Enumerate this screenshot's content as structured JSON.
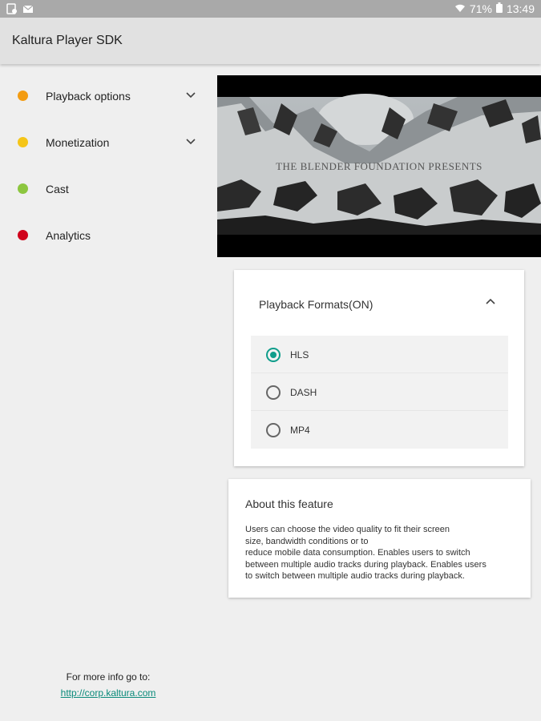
{
  "status_bar": {
    "left_icons": [
      "screen-mirroring-icon",
      "mail-icon"
    ],
    "battery_percent": "71%",
    "time": "13:49"
  },
  "app": {
    "title": "Kaltura Player SDK"
  },
  "menu": {
    "items": [
      {
        "label": "Playback options",
        "color": "#f39c12",
        "has_chevron": true
      },
      {
        "label": "Monetization",
        "color": "#f5c518",
        "has_chevron": true
      },
      {
        "label": "Cast",
        "color": "#8cc63f",
        "has_chevron": false
      },
      {
        "label": "Analytics",
        "color": "#d0021b",
        "has_chevron": false
      }
    ]
  },
  "footer": {
    "info_text": "For more info go to:",
    "link_text": "http://corp.kaltura.com"
  },
  "video": {
    "caption": "THE BLENDER FOUNDATION PRESENTS"
  },
  "playback_formats": {
    "title": "Playback Formats(ON)",
    "options": [
      {
        "label": "HLS",
        "selected": true
      },
      {
        "label": "DASH",
        "selected": false
      },
      {
        "label": "MP4",
        "selected": false
      }
    ]
  },
  "about": {
    "title": "About this feature",
    "lines": [
      "Users can choose the video quality to fit their screen",
      "size, bandwidth conditions or to",
      "reduce mobile data consumption. Enables users to switch",
      "between multiple audio tracks during playback. Enables users",
      "to switch between multiple audio tracks during playback."
    ]
  },
  "colors": {
    "accent": "#0f9d8b",
    "app_bar": "#e1e1e1",
    "status_bar": "#a9a9a9"
  }
}
